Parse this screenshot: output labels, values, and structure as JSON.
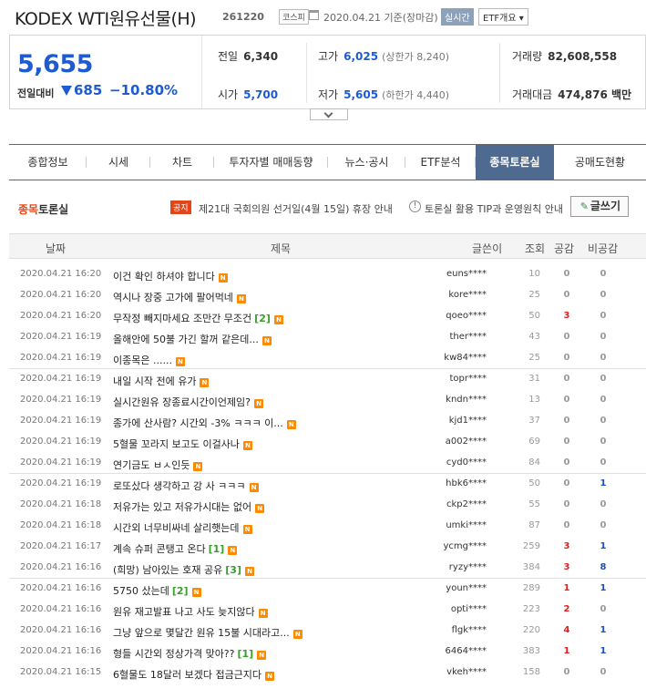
{
  "header": {
    "stock_name": "KODEX WTI원유선물(H)",
    "stock_code": "261220",
    "market_badge": "코스피",
    "date_text": "2020.04.21 기준(장마감)",
    "realtime_badge": "실시간",
    "etf_badge": "ETF개요 ▾"
  },
  "price": {
    "current": "5,655",
    "diff_label": "전일대비",
    "diff": "685",
    "pct": "−10.80%",
    "prev_close_label": "전일",
    "prev_close": "6,340",
    "high_label": "고가",
    "high": "6,025",
    "upper_limit": "(상한가 8,240)",
    "volume_label": "거래량",
    "volume": "82,608,558",
    "open_label": "시가",
    "open": "5,700",
    "low_label": "저가",
    "low": "5,605",
    "lower_limit": "(하한가 4,440)",
    "amount_label": "거래대금",
    "amount": "474,876 백만"
  },
  "tabs": [
    {
      "label": "종합정보",
      "active": false
    },
    {
      "label": "시세",
      "active": false
    },
    {
      "label": "차트",
      "active": false
    },
    {
      "label": "투자자별 매매동향",
      "active": false
    },
    {
      "label": "뉴스·공시",
      "active": false
    },
    {
      "label": "ETF분석",
      "active": false
    },
    {
      "label": "종목토론실",
      "active": true
    },
    {
      "label": "공매도현황",
      "active": false
    }
  ],
  "board": {
    "title_highlight": "종목",
    "title_rest": "토론실",
    "notice_badge": "공지",
    "notice_text": "제21대 국회의원 선거일(4월 15일) 휴장 안내",
    "tip_text": "토론실 활용 TIP과 운영원칙 안내",
    "write_label": "글쓰기"
  },
  "columns": {
    "date": "날짜",
    "title": "제목",
    "writer": "글쓴이",
    "views": "조회",
    "likes": "공감",
    "dislikes": "비공감"
  },
  "posts": [
    {
      "date": "2020.04.21 16:20",
      "title": "이건 확인 하셔야 합니다",
      "comments": "",
      "writer": "euns****",
      "views": "10",
      "likes": "0",
      "dislikes": "0"
    },
    {
      "date": "2020.04.21 16:20",
      "title": "역시나 장중 고가에 팔어먹네",
      "comments": "",
      "writer": "kore****",
      "views": "25",
      "likes": "0",
      "dislikes": "0"
    },
    {
      "date": "2020.04.21 16:20",
      "title": "무작정 빼지마세요 조만간 무조건",
      "comments": "[2]",
      "writer": "qoeo****",
      "views": "50",
      "likes": "3",
      "dislikes": "0"
    },
    {
      "date": "2020.04.21 16:19",
      "title": "올해안에 50불 가긴 할꺼 같은데...",
      "comments": "",
      "writer": "ther****",
      "views": "43",
      "likes": "0",
      "dislikes": "0"
    },
    {
      "date": "2020.04.21 16:19",
      "title": "이종목은 ......",
      "comments": "",
      "writer": "kw84****",
      "views": "25",
      "likes": "0",
      "dislikes": "0"
    },
    {
      "date": "2020.04.21 16:19",
      "title": "내일 시작 전에 유가",
      "comments": "",
      "writer": "topr****",
      "views": "31",
      "likes": "0",
      "dislikes": "0"
    },
    {
      "date": "2020.04.21 16:19",
      "title": "실시간원유 장종료시간이언제임?",
      "comments": "",
      "writer": "kndn****",
      "views": "13",
      "likes": "0",
      "dislikes": "0"
    },
    {
      "date": "2020.04.21 16:19",
      "title": "종가에 산사람? 시간외 -3% ㅋㅋㅋ 이...",
      "comments": "",
      "writer": "kjd1****",
      "views": "37",
      "likes": "0",
      "dislikes": "0"
    },
    {
      "date": "2020.04.21 16:19",
      "title": "5혈물 꼬라지 보고도 이걸사나",
      "comments": "",
      "writer": "a002****",
      "views": "69",
      "likes": "0",
      "dislikes": "0"
    },
    {
      "date": "2020.04.21 16:19",
      "title": "연기금도 ㅂㅅ인듯",
      "comments": "",
      "writer": "cyd0****",
      "views": "84",
      "likes": "0",
      "dislikes": "0"
    },
    {
      "date": "2020.04.21 16:19",
      "title": "로또샀다 생각하고 강 사 ㅋㅋㅋ",
      "comments": "",
      "writer": "hbk6****",
      "views": "50",
      "likes": "0",
      "dislikes": "1"
    },
    {
      "date": "2020.04.21 16:18",
      "title": "저유가는 있고 저유가시대는 없어",
      "comments": "",
      "writer": "ckp2****",
      "views": "55",
      "likes": "0",
      "dislikes": "0"
    },
    {
      "date": "2020.04.21 16:18",
      "title": "시간외 너무비싸네 살리햇는데",
      "comments": "",
      "writer": "umki****",
      "views": "87",
      "likes": "0",
      "dislikes": "0"
    },
    {
      "date": "2020.04.21 16:17",
      "title": "계속 슈퍼 콘탱고 온다",
      "comments": "[1]",
      "writer": "ycmg****",
      "views": "259",
      "likes": "3",
      "dislikes": "1"
    },
    {
      "date": "2020.04.21 16:16",
      "title": "(희망) 남아있는 호재 공유",
      "comments": "[3]",
      "writer": "ryzy****",
      "views": "384",
      "likes": "3",
      "dislikes": "8"
    },
    {
      "date": "2020.04.21 16:16",
      "title": "5750 샀는데",
      "comments": "[2]",
      "writer": "youn****",
      "views": "289",
      "likes": "1",
      "dislikes": "1"
    },
    {
      "date": "2020.04.21 16:16",
      "title": "원유 재고발표 나고 사도 늦지않다",
      "comments": "",
      "writer": "opti****",
      "views": "223",
      "likes": "2",
      "dislikes": "0"
    },
    {
      "date": "2020.04.21 16:16",
      "title": "그냥 앞으로 몇달간 원유 15불 시대라고...",
      "comments": "",
      "writer": "flgk****",
      "views": "220",
      "likes": "4",
      "dislikes": "1"
    },
    {
      "date": "2020.04.21 16:16",
      "title": "형들 시간외 정상가격 맞아??",
      "comments": "[1]",
      "writer": "6464****",
      "views": "383",
      "likes": "1",
      "dislikes": "1"
    },
    {
      "date": "2020.04.21 16:15",
      "title": "6혈물도 18달러 보겠다 접금근지다",
      "comments": "",
      "writer": "vkeh****",
      "views": "158",
      "likes": "0",
      "dislikes": "0"
    }
  ],
  "new_badge": "N",
  "colors": {
    "accent_blue": "#1e5bd1",
    "tab_active": "#4f6a91",
    "red": "#e02020",
    "new_badge": "#ff8a00"
  }
}
